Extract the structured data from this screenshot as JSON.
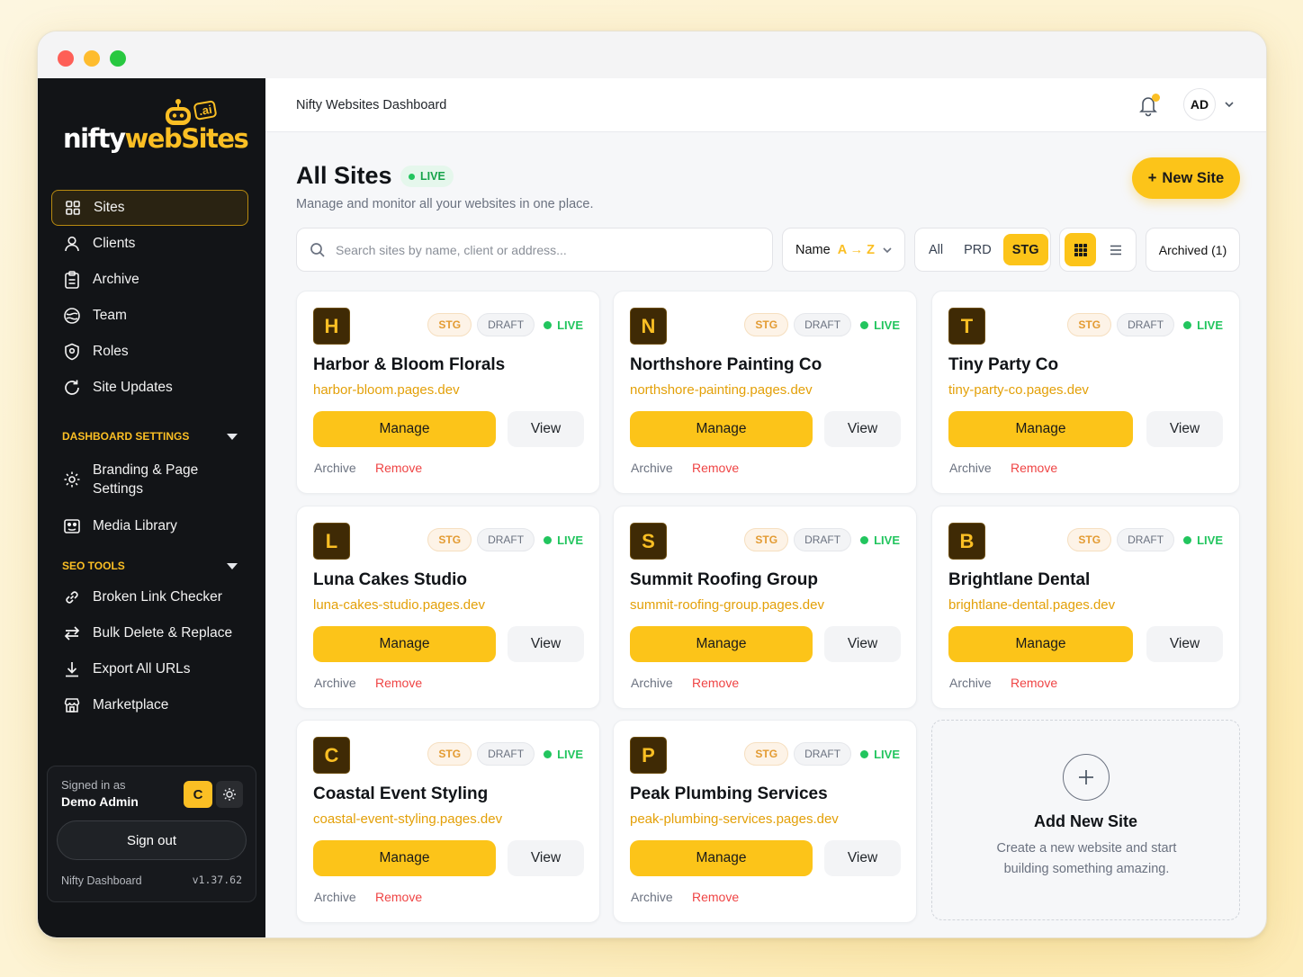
{
  "brand": {
    "logo_text_white": "nifty",
    "logo_text_yellow": "webSites",
    "logo_badge": ".ai"
  },
  "colors": {
    "accent": "#fcc419",
    "sidebar_bg": "#121417",
    "live_green": "#22c55e",
    "remove_red": "#ef4444",
    "url_amber": "#e3a008"
  },
  "sidebar": {
    "items": [
      {
        "label": "Sites",
        "icon": "grid-icon",
        "active": true
      },
      {
        "label": "Clients",
        "icon": "user-icon"
      },
      {
        "label": "Archive",
        "icon": "clipboard-icon"
      },
      {
        "label": "Team",
        "icon": "team-icon"
      },
      {
        "label": "Roles",
        "icon": "shield-icon"
      },
      {
        "label": "Site Updates",
        "icon": "refresh-icon"
      }
    ],
    "dashboard_settings": {
      "header": "DASHBOARD SETTINGS",
      "items": [
        {
          "label": "Branding & Page Settings",
          "icon": "gear-icon"
        },
        {
          "label": "Media Library",
          "icon": "media-icon"
        }
      ]
    },
    "seo_tools": {
      "header": "SEO TOOLS",
      "items": [
        {
          "label": "Broken Link Checker",
          "icon": "link-icon"
        },
        {
          "label": "Bulk Delete & Replace",
          "icon": "swap-icon"
        },
        {
          "label": "Export All URLs",
          "icon": "download-icon"
        },
        {
          "label": "Marketplace",
          "icon": "store-icon"
        }
      ]
    },
    "user": {
      "signed_in_as": "Signed in as",
      "name": "Demo Admin",
      "badge": "C",
      "sign_out": "Sign out",
      "footer_name": "Nifty Dashboard",
      "version": "v1.37.62"
    }
  },
  "topbar": {
    "breadcrumb": "Nifty Websites Dashboard",
    "avatar_initials": "AD"
  },
  "page": {
    "title": "All Sites",
    "status": "LIVE",
    "subtitle": "Manage and monitor all your websites in one place.",
    "new_site": "New Site",
    "new_site_plus": "+"
  },
  "filters": {
    "search_placeholder": "Search sites by name, client or address...",
    "sort_label": "Name",
    "sort_dir": "A → Z",
    "env_options": [
      "All",
      "PRD",
      "STG"
    ],
    "env_selected": "STG",
    "view_selected": "grid",
    "archived": "Archived (1)"
  },
  "card_labels": {
    "stg": "STG",
    "draft": "DRAFT",
    "live": "LIVE",
    "manage": "Manage",
    "view": "View",
    "archive": "Archive",
    "remove": "Remove"
  },
  "sites": [
    {
      "letter": "H",
      "name": "Harbor & Bloom Florals",
      "url": "harbor-bloom.pages.dev"
    },
    {
      "letter": "N",
      "name": "Northshore Painting Co",
      "url": "northshore-painting.pages.dev"
    },
    {
      "letter": "T",
      "name": "Tiny Party Co",
      "url": "tiny-party-co.pages.dev"
    },
    {
      "letter": "L",
      "name": "Luna Cakes Studio",
      "url": "luna-cakes-studio.pages.dev"
    },
    {
      "letter": "S",
      "name": "Summit Roofing Group",
      "url": "summit-roofing-group.pages.dev"
    },
    {
      "letter": "B",
      "name": "Brightlane Dental",
      "url": "brightlane-dental.pages.dev"
    },
    {
      "letter": "C",
      "name": "Coastal Event Styling",
      "url": "coastal-event-styling.pages.dev"
    },
    {
      "letter": "P",
      "name": "Peak Plumbing Services",
      "url": "peak-plumbing-services.pages.dev"
    }
  ],
  "add_card": {
    "title": "Add New Site",
    "description": "Create a new website and start building something amazing."
  }
}
